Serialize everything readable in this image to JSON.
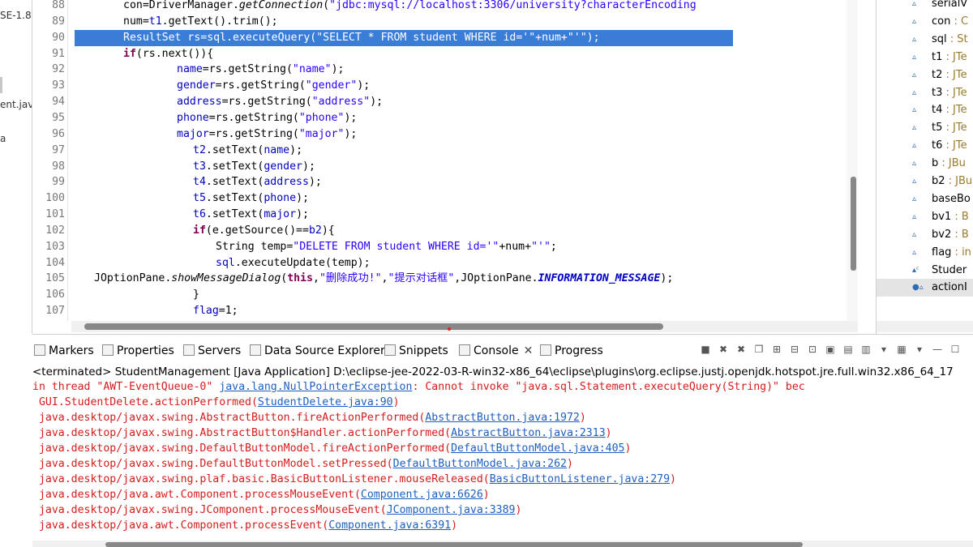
{
  "left_pane": {
    "lines": [
      "SE-1.8",
      "ent.jav",
      "a"
    ]
  },
  "editor": {
    "lines": [
      {
        "num": "88",
        "indent": 112,
        "segments": [
          {
            "t": "con=DriverManager.",
            "c": ""
          },
          {
            "t": "getConnection",
            "c": "itl"
          },
          {
            "t": "(",
            "c": ""
          },
          {
            "t": "\"jdbc:mysql://localhost:3306/university?characterEncoding",
            "c": "str"
          }
        ]
      },
      {
        "num": "89",
        "indent": 112,
        "segments": [
          {
            "t": "num=",
            "c": ""
          },
          {
            "t": "t1",
            "c": "fld"
          },
          {
            "t": ".getText().trim();",
            "c": ""
          }
        ]
      },
      {
        "num": "90",
        "indent": 112,
        "highlight": true,
        "segments": [
          {
            "t": "ResultSet rs=",
            "c": ""
          },
          {
            "t": "sql",
            "c": ""
          },
          {
            "t": ".executeQuery(\"SELECT * FROM student WHERE id='\"+num+\"'\");",
            "c": ""
          }
        ]
      },
      {
        "num": "91",
        "indent": 112,
        "segments": [
          {
            "t": "if",
            "c": "kw"
          },
          {
            "t": "(rs.next()){",
            "c": ""
          }
        ]
      },
      {
        "num": "92",
        "indent": 178,
        "segments": [
          {
            "t": "name",
            "c": "fld"
          },
          {
            "t": "=rs.getString(",
            "c": ""
          },
          {
            "t": "\"name\"",
            "c": "str"
          },
          {
            "t": ");",
            "c": ""
          }
        ]
      },
      {
        "num": "93",
        "indent": 178,
        "segments": [
          {
            "t": "gender",
            "c": "fld"
          },
          {
            "t": "=rs.getString(",
            "c": ""
          },
          {
            "t": "\"gender\"",
            "c": "str"
          },
          {
            "t": ");",
            "c": ""
          }
        ]
      },
      {
        "num": "94",
        "indent": 178,
        "segments": [
          {
            "t": "address",
            "c": "fld"
          },
          {
            "t": "=rs.getString(",
            "c": ""
          },
          {
            "t": "\"address\"",
            "c": "str"
          },
          {
            "t": ");",
            "c": ""
          }
        ]
      },
      {
        "num": "95",
        "indent": 178,
        "segments": [
          {
            "t": "phone",
            "c": "fld"
          },
          {
            "t": "=rs.getString(",
            "c": ""
          },
          {
            "t": "\"phone\"",
            "c": "str"
          },
          {
            "t": ");",
            "c": ""
          }
        ]
      },
      {
        "num": "96",
        "indent": 178,
        "segments": [
          {
            "t": "major",
            "c": "fld"
          },
          {
            "t": "=rs.getString(",
            "c": ""
          },
          {
            "t": "\"major\"",
            "c": "str"
          },
          {
            "t": ");",
            "c": ""
          }
        ]
      },
      {
        "num": "97",
        "indent": 198,
        "segments": [
          {
            "t": "t2",
            "c": "fld"
          },
          {
            "t": ".setText(",
            "c": ""
          },
          {
            "t": "name",
            "c": "fld"
          },
          {
            "t": ");",
            "c": ""
          }
        ]
      },
      {
        "num": "98",
        "indent": 198,
        "segments": [
          {
            "t": "t3",
            "c": "fld"
          },
          {
            "t": ".setText(",
            "c": ""
          },
          {
            "t": "gender",
            "c": "fld"
          },
          {
            "t": ");",
            "c": ""
          }
        ]
      },
      {
        "num": "99",
        "indent": 198,
        "segments": [
          {
            "t": "t4",
            "c": "fld"
          },
          {
            "t": ".setText(",
            "c": ""
          },
          {
            "t": "address",
            "c": "fld"
          },
          {
            "t": ");",
            "c": ""
          }
        ]
      },
      {
        "num": "100",
        "indent": 198,
        "segments": [
          {
            "t": "t5",
            "c": "fld"
          },
          {
            "t": ".setText(",
            "c": ""
          },
          {
            "t": "phone",
            "c": "fld"
          },
          {
            "t": ");",
            "c": ""
          }
        ]
      },
      {
        "num": "101",
        "indent": 198,
        "segments": [
          {
            "t": "t6",
            "c": "fld"
          },
          {
            "t": ".setText(",
            "c": ""
          },
          {
            "t": "major",
            "c": "fld"
          },
          {
            "t": ");",
            "c": ""
          }
        ]
      },
      {
        "num": "102",
        "indent": 198,
        "segments": [
          {
            "t": "if",
            "c": "kw"
          },
          {
            "t": "(e.getSource()==",
            "c": ""
          },
          {
            "t": "b2",
            "c": "fld"
          },
          {
            "t": "){",
            "c": ""
          }
        ]
      },
      {
        "num": "103",
        "indent": 226,
        "segments": [
          {
            "t": "String temp=",
            "c": ""
          },
          {
            "t": "\"DELETE FROM student WHERE id='\"",
            "c": "str"
          },
          {
            "t": "+num+",
            "c": ""
          },
          {
            "t": "\"'\"",
            "c": "str"
          },
          {
            "t": ";",
            "c": ""
          }
        ]
      },
      {
        "num": "104",
        "indent": 226,
        "segments": [
          {
            "t": "sql",
            "c": "fld"
          },
          {
            "t": ".executeUpdate(temp);",
            "c": ""
          }
        ]
      },
      {
        "num": "105",
        "indent": 76,
        "segments": [
          {
            "t": "JOptionPane.",
            "c": ""
          },
          {
            "t": "showMessageDialog",
            "c": "itl"
          },
          {
            "t": "(",
            "c": ""
          },
          {
            "t": "this",
            "c": "kw"
          },
          {
            "t": ",",
            "c": ""
          },
          {
            "t": "\"删除成功!\"",
            "c": "str"
          },
          {
            "t": ",",
            "c": ""
          },
          {
            "t": "\"提示对话框\"",
            "c": "str"
          },
          {
            "t": ",JOptionPane.",
            "c": ""
          },
          {
            "t": "INFORMATION_MESSAGE",
            "c": "stf"
          },
          {
            "t": ");",
            "c": ""
          }
        ]
      },
      {
        "num": "106",
        "indent": 198,
        "segments": [
          {
            "t": "}",
            "c": ""
          }
        ]
      },
      {
        "num": "107",
        "indent": 198,
        "segments": [
          {
            "t": "flag",
            "c": "fld"
          },
          {
            "t": "=1;",
            "c": ""
          }
        ]
      }
    ]
  },
  "outline": {
    "items": [
      {
        "icon": "▵",
        "name": "serialV",
        "type": ""
      },
      {
        "icon": "▵",
        "name": "con",
        "type": " : C"
      },
      {
        "icon": "▵",
        "name": "sql",
        "type": " : St"
      },
      {
        "icon": "▵",
        "name": "t1",
        "type": " : JTe"
      },
      {
        "icon": "▵",
        "name": "t2",
        "type": " : JTe"
      },
      {
        "icon": "▵",
        "name": "t3",
        "type": " : JTe"
      },
      {
        "icon": "▵",
        "name": "t4",
        "type": " : JTe"
      },
      {
        "icon": "▵",
        "name": "t5",
        "type": " : JTe"
      },
      {
        "icon": "▵",
        "name": "t6",
        "type": " : JTe"
      },
      {
        "icon": "▵",
        "name": "b",
        "type": " : JBu"
      },
      {
        "icon": "▵",
        "name": "b2",
        "type": " : JBu"
      },
      {
        "icon": "▵",
        "name": "baseBo",
        "type": ""
      },
      {
        "icon": "▵",
        "name": "bv1",
        "type": " : B"
      },
      {
        "icon": "▵",
        "name": "bv2",
        "type": " : B"
      },
      {
        "icon": "▵",
        "name": "flag",
        "type": " : in"
      },
      {
        "icon": "▴ᶜ",
        "name": "Studer",
        "type": ""
      },
      {
        "icon": "●▵",
        "name": "actionI",
        "type": ""
      }
    ]
  },
  "console": {
    "tabs": [
      {
        "label": "Markers",
        "active": false
      },
      {
        "label": "Properties",
        "active": false
      },
      {
        "label": "Servers",
        "active": false
      },
      {
        "label": "Data Source Explorer",
        "active": false
      },
      {
        "label": "Snippets",
        "active": false
      },
      {
        "label": "Console",
        "active": true,
        "close": "✕"
      },
      {
        "label": "Progress",
        "active": false
      }
    ],
    "toolbar_icons": [
      "■",
      "✖",
      "✖",
      "❐",
      "⊞",
      "⊟",
      "⊡",
      "▣",
      "▤",
      "▥",
      "▾",
      "▦",
      "▾",
      "—",
      "☐"
    ],
    "status": "<terminated> StudentManagement [Java Application] D:\\eclipse-jee-2022-03-R-win32-x86_64\\eclipse\\plugins\\org.eclipse.justj.openjdk.hotspot.jre.full.win32.x86_64_17",
    "lines": [
      {
        "pre": "in thread \"AWT-EventQueue-0\" ",
        "link": "java.lang.NullPointerException",
        "post": ": Cannot invoke \"java.sql.Statement.executeQuery(String)\" bec"
      },
      {
        "pre": " GUI.StudentDelete.actionPerformed(",
        "link": "StudentDelete.java:90",
        "post": ")"
      },
      {
        "pre": " java.desktop/javax.swing.AbstractButton.fireActionPerformed(",
        "link": "AbstractButton.java:1972",
        "post": ")"
      },
      {
        "pre": " java.desktop/javax.swing.AbstractButton$Handler.actionPerformed(",
        "link": "AbstractButton.java:2313",
        "post": ")"
      },
      {
        "pre": " java.desktop/javax.swing.DefaultButtonModel.fireActionPerformed(",
        "link": "DefaultButtonModel.java:405",
        "post": ")"
      },
      {
        "pre": " java.desktop/javax.swing.DefaultButtonModel.setPressed(",
        "link": "DefaultButtonModel.java:262",
        "post": ")"
      },
      {
        "pre": " java.desktop/javax.swing.plaf.basic.BasicButtonListener.mouseReleased(",
        "link": "BasicButtonListener.java:279",
        "post": ")"
      },
      {
        "pre": " java.desktop/java.awt.Component.processMouseEvent(",
        "link": "Component.java:6626",
        "post": ")"
      },
      {
        "pre": " java.desktop/javax.swing.JComponent.processMouseEvent(",
        "link": "JComponent.java:3389",
        "post": ")"
      },
      {
        "pre": " java.desktop/java.awt.Component.processEvent(",
        "link": "Component.java:6391",
        "post": ")"
      }
    ]
  }
}
